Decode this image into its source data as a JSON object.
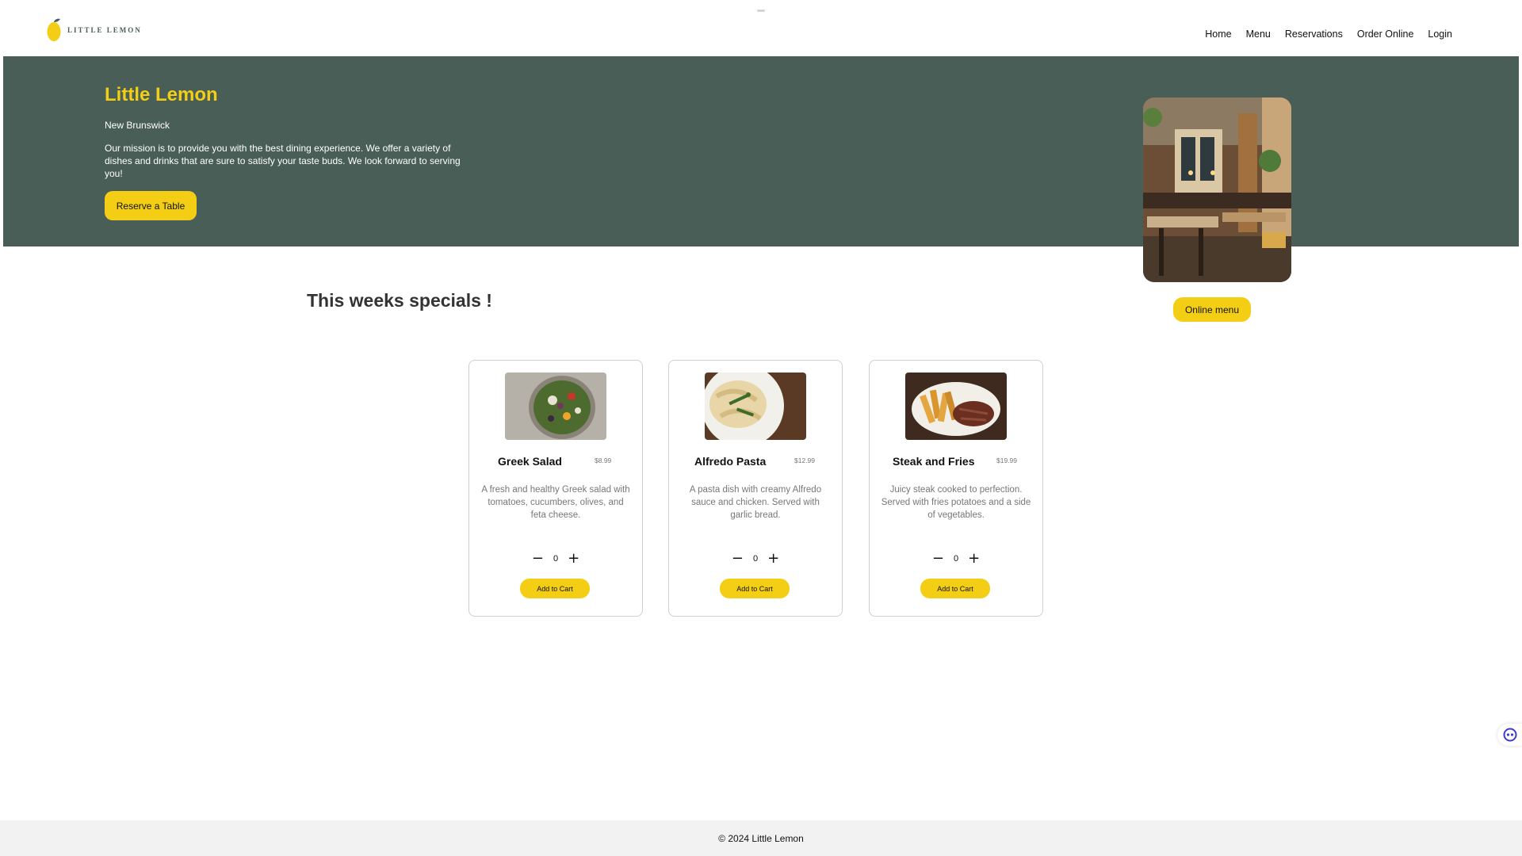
{
  "brand": {
    "logo_text": "LITTLE LEMON"
  },
  "nav": {
    "items": [
      {
        "label": "Home"
      },
      {
        "label": "Menu"
      },
      {
        "label": "Reservations"
      },
      {
        "label": "Order Online"
      },
      {
        "label": "Login"
      }
    ]
  },
  "hero": {
    "title": "Little Lemon",
    "city": "New Brunswick",
    "description": "Our mission is to provide you with the best dining experience. We offer a variety of dishes and drinks that are sure to satisfy your taste buds. We look forward to serving you!",
    "reserve_label": "Reserve a Table",
    "online_menu_label": "Online menu"
  },
  "specials": {
    "title": "This weeks specials !",
    "items": [
      {
        "name": "Greek Salad",
        "price": "$8.99",
        "description": "A fresh and healthy Greek salad with tomatoes, cucumbers, olives, and feta cheese.",
        "quantity": "0",
        "add_label": "Add to Cart"
      },
      {
        "name": "Alfredo Pasta",
        "price": "$12.99",
        "description": "A pasta dish with creamy Alfredo sauce and chicken. Served with garlic bread.",
        "quantity": "0",
        "add_label": "Add to Cart"
      },
      {
        "name": "Steak and Fries",
        "price": "$19.99",
        "description": "Juicy steak cooked to perfection. Served with fries potatoes and a side of vegetables.",
        "quantity": "0",
        "add_label": "Add to Cart"
      }
    ]
  },
  "footer": {
    "copyright": "© 2024 Little Lemon"
  },
  "colors": {
    "primary_green": "#495e57",
    "accent_yellow": "#f4ce14"
  },
  "icons": {
    "minus": "minus-icon",
    "plus": "plus-icon",
    "widget": "assistant-icon"
  }
}
